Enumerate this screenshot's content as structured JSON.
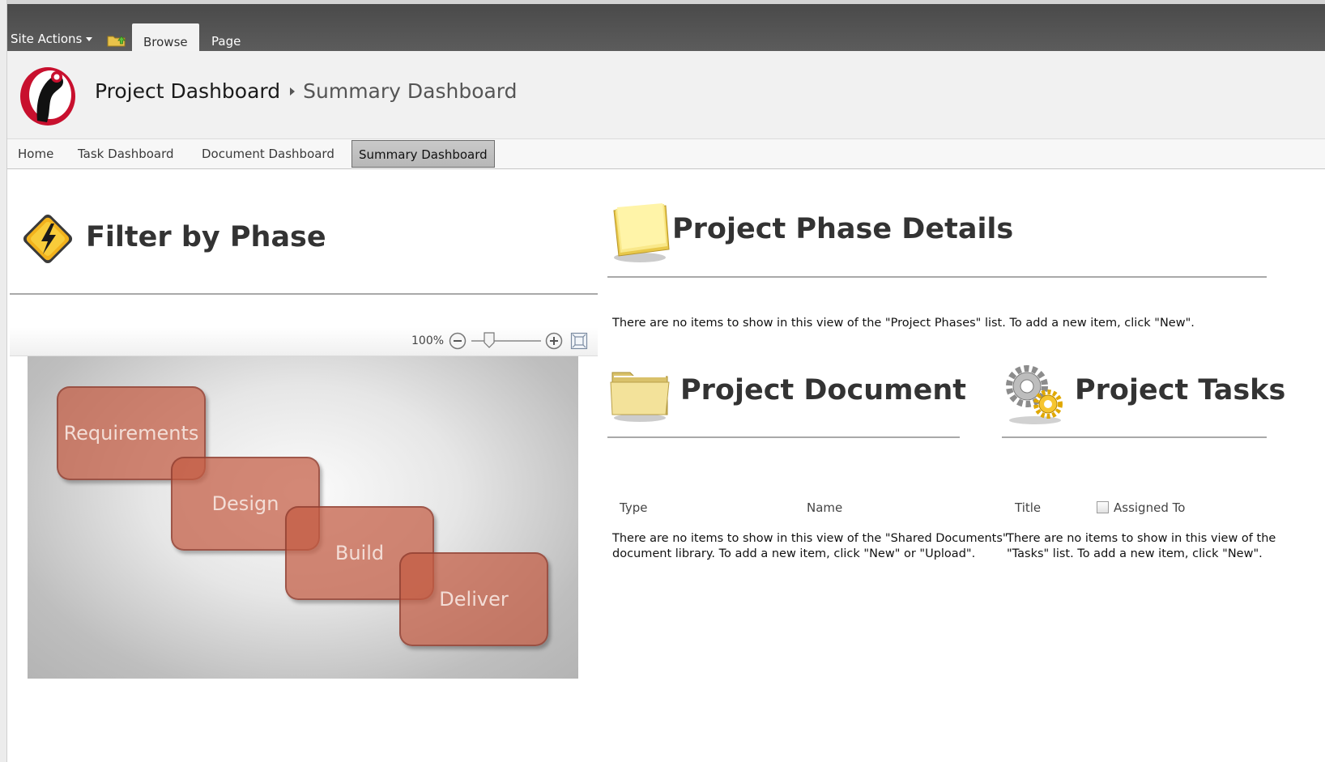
{
  "ribbon": {
    "site_actions": "Site Actions",
    "tabs": [
      "Browse",
      "Page"
    ]
  },
  "breadcrumb": {
    "site": "Project Dashboard",
    "current": "Summary Dashboard"
  },
  "topnav": {
    "items": [
      "Home",
      "Task Dashboard",
      "Document Dashboard",
      "Summary Dashboard"
    ],
    "selected": "Summary Dashboard"
  },
  "filter": {
    "title": "Filter by Phase",
    "zoom": "100%",
    "phases": [
      "Requirements",
      "Design",
      "Build",
      "Deliver"
    ]
  },
  "phase_details": {
    "title": "Project Phase Details",
    "empty_msg": "There are no items to show in this view of the \"Project Phases\" list. To add a new item, click \"New\"."
  },
  "documents": {
    "title": "Project Document",
    "columns": [
      "Type",
      "Name"
    ],
    "empty_msg_1": "There are no items to show in this view of the \"Shared Documents\"",
    "empty_msg_2": "document library. To add a new item, click \"New\" or \"Upload\"."
  },
  "tasks": {
    "title": "Project Tasks",
    "columns": [
      "Title",
      "Assigned To"
    ],
    "empty_msg_1": "There are no items to show in this view of the",
    "empty_msg_2": "\"Tasks\" list. To add a new item, click \"New\"."
  },
  "colors": {
    "ribbon": "#4f4f4f",
    "phase_box": "#c45c42",
    "selected_nav": "#c0c0c0"
  }
}
